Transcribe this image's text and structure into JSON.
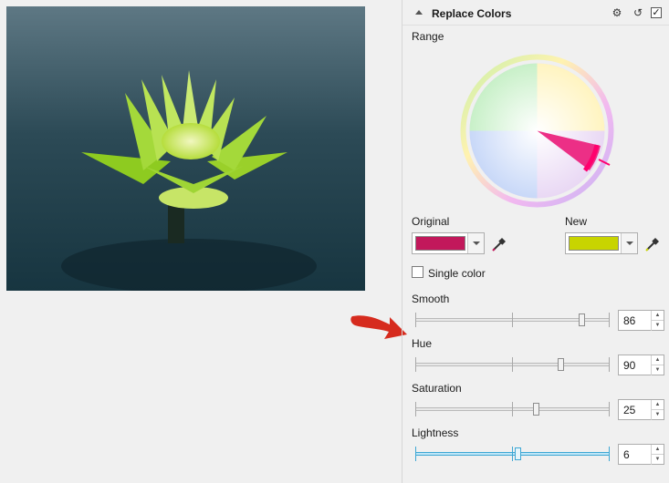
{
  "panel": {
    "title": "Replace Colors",
    "icons": [
      "gear-icon",
      "reset-icon",
      "enabled-checkbox"
    ],
    "range_label": "Range",
    "original_label": "Original",
    "new_label": "New",
    "original_color": "#c2185b",
    "new_color": "#c8d400",
    "single_color_label": "Single color",
    "sliders": [
      {
        "label": "Smooth",
        "value": "86",
        "position": 0.86
      },
      {
        "label": "Hue",
        "value": "90",
        "position": 0.74
      },
      {
        "label": "Saturation",
        "value": "25",
        "position": 0.62
      },
      {
        "label": "Lightness",
        "value": "6",
        "position": 0.52
      }
    ]
  },
  "accent": "#3ea7d4",
  "annotation_color": "#d62b1e"
}
